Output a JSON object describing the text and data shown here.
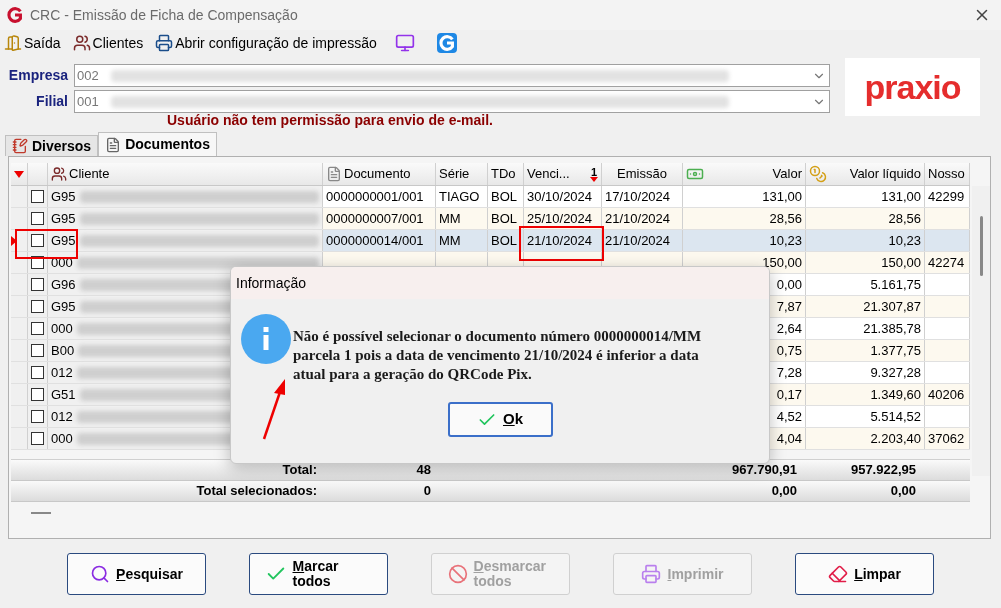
{
  "window": {
    "title": "CRC - Emissão de Ficha de Compensação"
  },
  "toolbar": [
    {
      "kind": "exit",
      "label": "Saída"
    },
    {
      "kind": "clients",
      "label": "Clientes"
    },
    {
      "kind": "print",
      "label": "Abrir configuração de impressão"
    },
    {
      "kind": "monitor"
    },
    {
      "kind": "app"
    }
  ],
  "fields": [
    {
      "label": "Empresa",
      "value": "002"
    },
    {
      "label": "Filial",
      "value": "001"
    }
  ],
  "logo": "praxio",
  "warning": "Usuário não tem permissão para envio de e-mail.",
  "tabs": [
    {
      "label": "Diversos",
      "kind": "notes",
      "selected": false
    },
    {
      "label": "Documentos",
      "kind": "docs",
      "selected": true
    }
  ],
  "table": {
    "columns": [
      "Cliente",
      "Documento",
      "Série",
      "TDo",
      "Venci...",
      "Emissão",
      "Valor",
      "Valor líquido",
      "Nosso"
    ],
    "sort_order": "1",
    "rows": [
      {
        "checked": false,
        "selected": false,
        "client": "G95",
        "documento": "0000000001/001",
        "serie": "TIAGO",
        "tdo": "BOL",
        "vencimento": "30/10/2024",
        "emissao": "17/10/2024",
        "valor": "131,00",
        "liquido": "131,00",
        "nosso": "42299"
      },
      {
        "checked": false,
        "selected": false,
        "client": "G95",
        "documento": "0000000007/001",
        "serie": "MM",
        "tdo": "BOL",
        "vencimento": "25/10/2024",
        "emissao": "21/10/2024",
        "valor": "28,56",
        "liquido": "28,56"
      },
      {
        "checked": false,
        "selected": true,
        "client": "G95",
        "documento": "0000000014/001",
        "serie": "MM",
        "tdo": "BOL",
        "vencimento": "21/10/2024",
        "emissao": "21/10/2024",
        "valor": "10,23",
        "liquido": "10,23"
      },
      {
        "checked": false,
        "selected": false,
        "client": "000",
        "valor": "150,00",
        "liquido": "150,00",
        "nosso": "42274"
      },
      {
        "checked": false,
        "selected": false,
        "client": "G96",
        "valor": "0,00",
        "liquido": "5.161,75"
      },
      {
        "checked": false,
        "selected": false,
        "client": "G95",
        "valor": "7,87",
        "liquido": "21.307,87"
      },
      {
        "checked": false,
        "selected": false,
        "client": "000",
        "valor": "2,64",
        "liquido": "21.385,78"
      },
      {
        "checked": false,
        "selected": false,
        "client": "B00",
        "valor": "0,75",
        "liquido": "1.377,75"
      },
      {
        "checked": false,
        "selected": false,
        "client": "012",
        "valor": "7,28",
        "liquido": "9.327,28"
      },
      {
        "checked": false,
        "selected": false,
        "client": "G51",
        "valor": "0,17",
        "liquido": "1.349,60",
        "nosso": "40206"
      },
      {
        "checked": false,
        "selected": false,
        "client": "012",
        "valor": "4,52",
        "liquido": "5.514,52"
      },
      {
        "checked": false,
        "selected": false,
        "client": "000",
        "valor": "4,04",
        "liquido": "2.203,40",
        "nosso": "37062"
      }
    ],
    "totals": [
      {
        "label": "Total:",
        "count": "48",
        "valor": "967.790,91",
        "liquido": "957.922,95"
      },
      {
        "label": "Total selecionados:",
        "count": "0",
        "valor": "0,00",
        "liquido": "0,00"
      }
    ]
  },
  "dialog": {
    "title": "Informação",
    "message": "Não é possível selecionar o documento número 0000000014/MM parcela 1 pois a data de vencimento 21/10/2024 é inferior a data atual para a geração do QRCode Pix.",
    "button": "Ok"
  },
  "buttons": [
    {
      "kind": "search",
      "label": "Pesquisar",
      "disabled": false
    },
    {
      "kind": "check",
      "label": "Marcar todos",
      "disabled": false
    },
    {
      "kind": "uncheck",
      "label": "Desmarcar todos",
      "disabled": true
    },
    {
      "kind": "print",
      "label": "Imprimir",
      "disabled": true
    },
    {
      "kind": "eraser",
      "label": "Limpar",
      "disabled": false
    }
  ]
}
